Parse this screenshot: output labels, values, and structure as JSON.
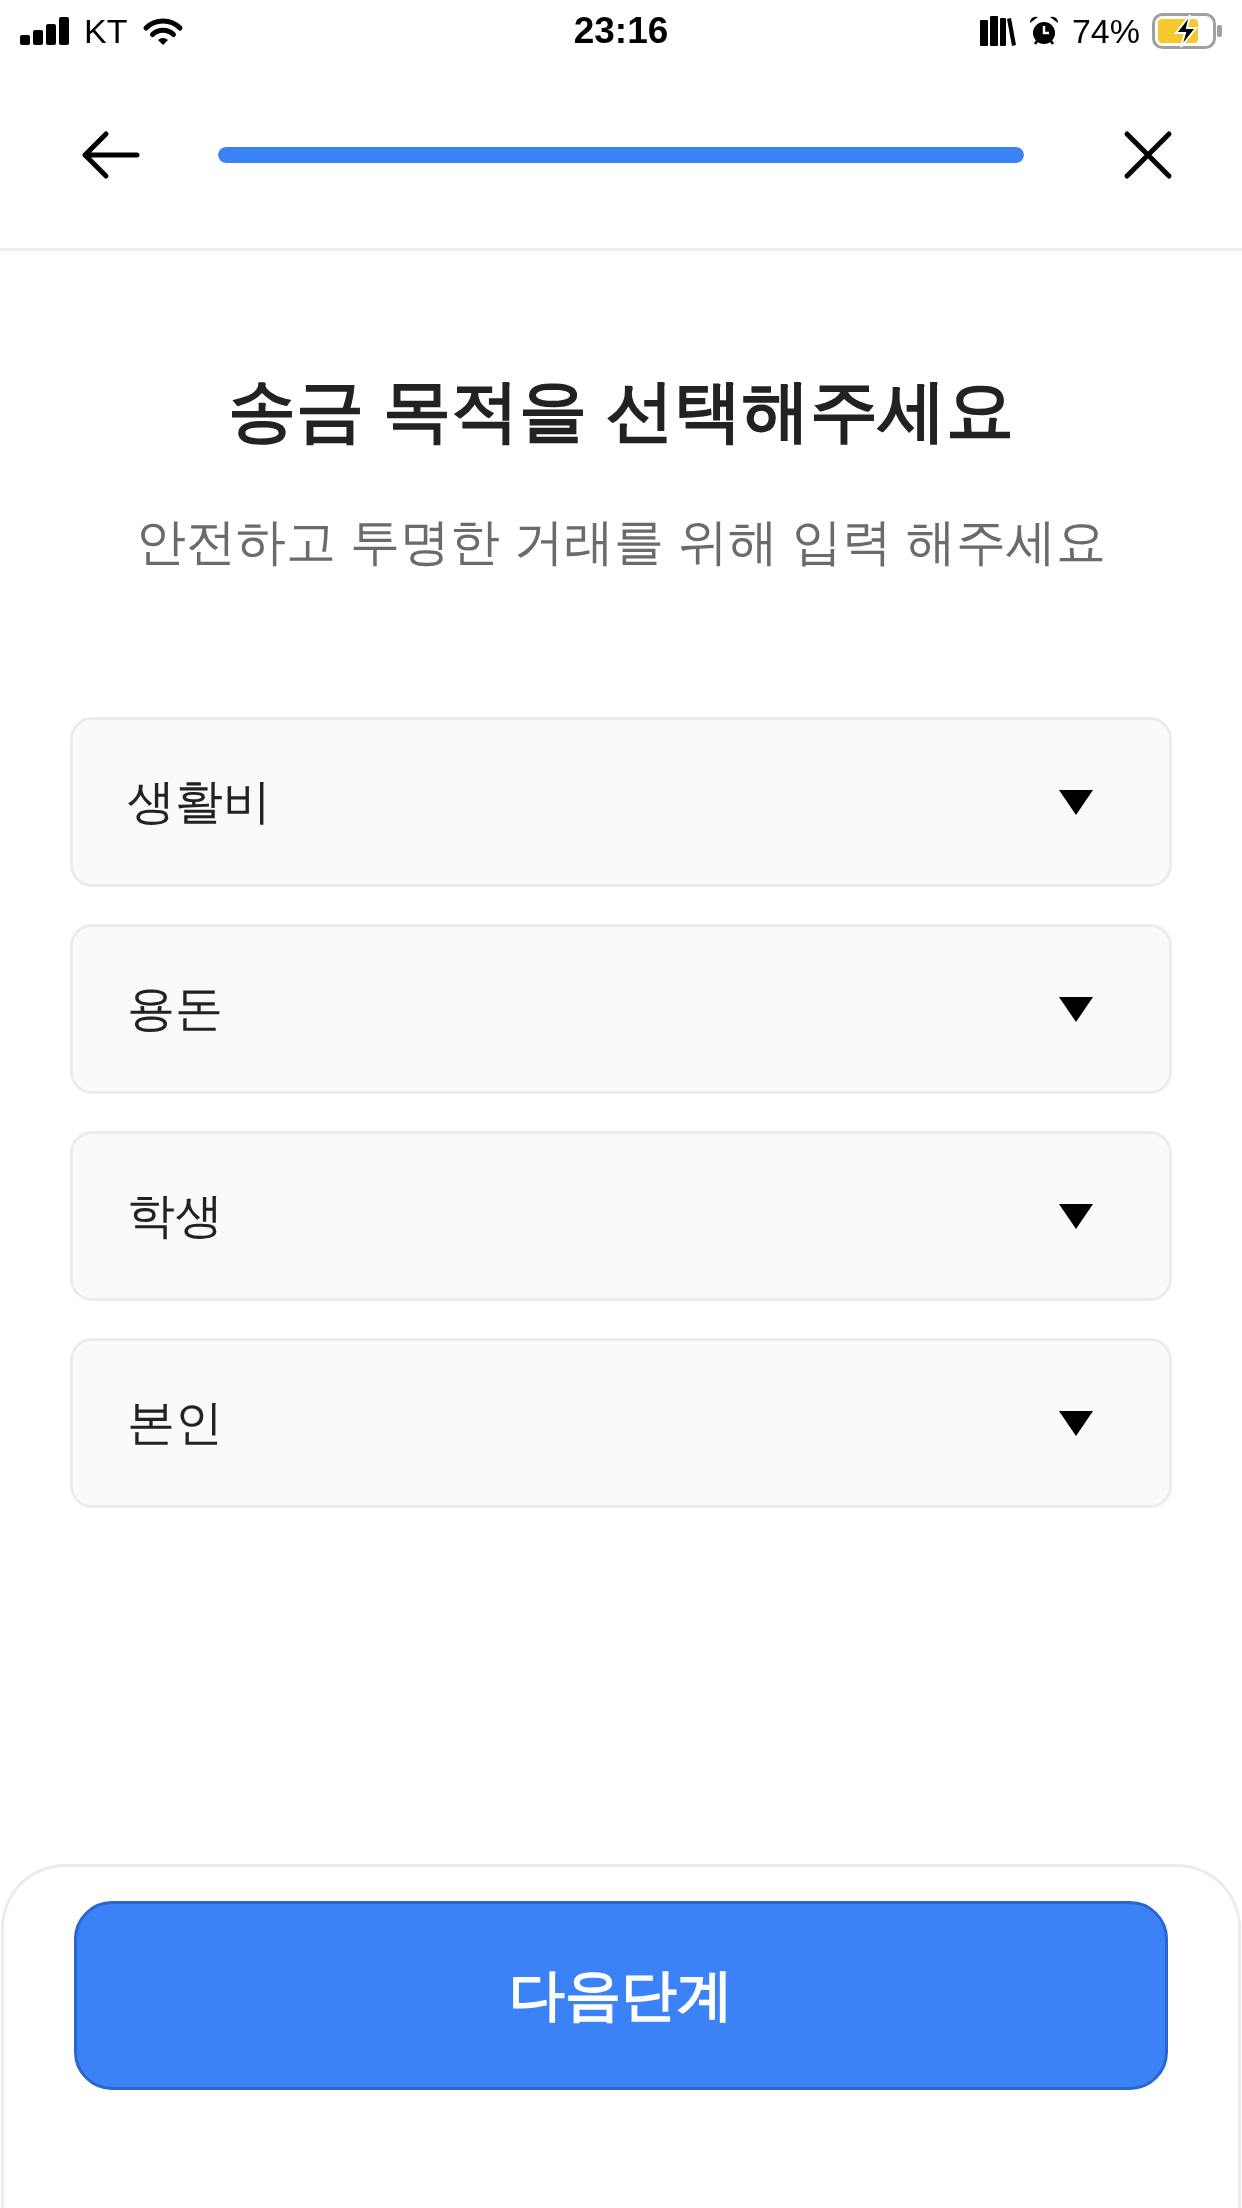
{
  "status_bar": {
    "carrier": "KT",
    "time": "23:16",
    "battery": "74%"
  },
  "header": {
    "progress": {
      "level": 1
    }
  },
  "title": "송금 목적을 선택해주세요",
  "subtitle": "안전하고 투명한 거래를 위해 입력 해주세요",
  "dropdowns": [
    {
      "value": "생활비"
    },
    {
      "value": "용돈"
    },
    {
      "value": "학생"
    },
    {
      "value": "본인"
    }
  ],
  "next_button": {
    "label": "다음단계"
  }
}
